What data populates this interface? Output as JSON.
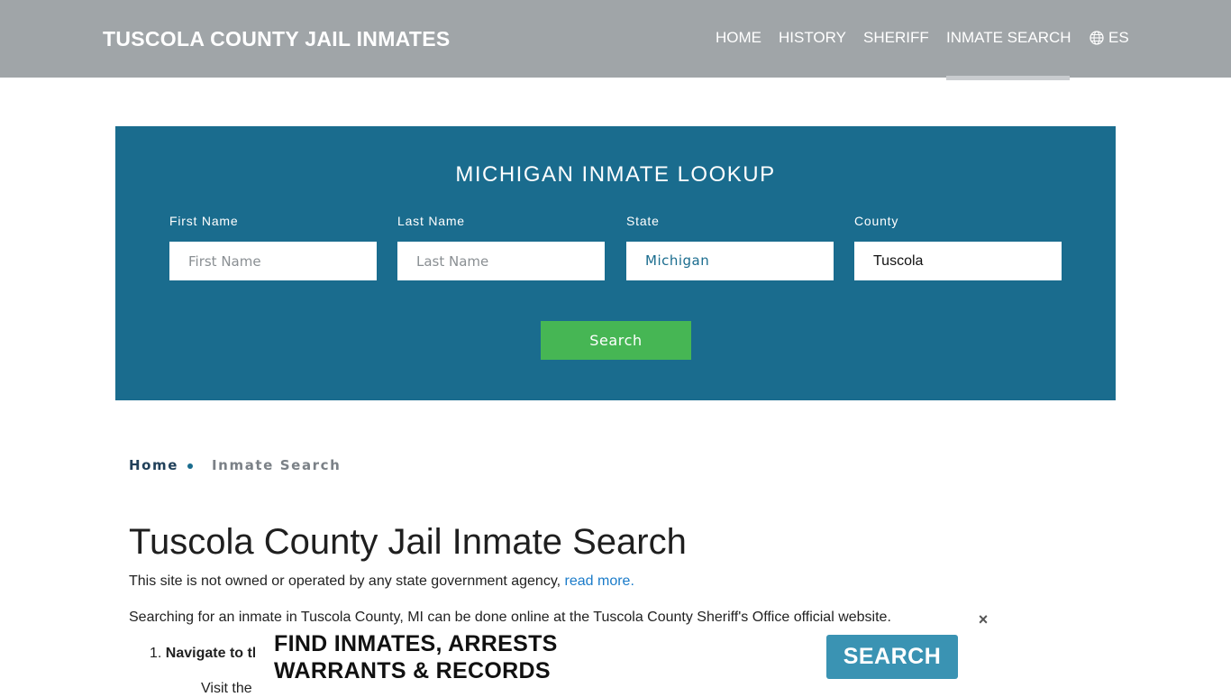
{
  "header": {
    "brand": "TUSCOLA COUNTY JAIL INMATES",
    "nav": [
      {
        "label": "HOME"
      },
      {
        "label": "HISTORY"
      },
      {
        "label": "SHERIFF"
      },
      {
        "label": "INMATE SEARCH",
        "active": true
      },
      {
        "label": "ES",
        "icon": "globe-icon"
      }
    ]
  },
  "lookup": {
    "title": "MICHIGAN INMATE LOOKUP",
    "first_name": {
      "label": "First Name",
      "placeholder": "First Name",
      "value": ""
    },
    "last_name": {
      "label": "Last Name",
      "placeholder": "Last Name",
      "value": ""
    },
    "state": {
      "label": "State",
      "value": "Michigan"
    },
    "county": {
      "label": "County",
      "value": "Tuscola"
    },
    "search_label": "Search"
  },
  "breadcrumb": {
    "home": "Home",
    "current": "Inmate Search"
  },
  "content": {
    "title": "Tuscola County Jail Inmate Search",
    "disclaimer_text": "This site is not owned or operated by any state government agency, ",
    "disclaimer_link": "read more.",
    "paragraph": "Searching for an inmate in Tuscola County, MI can be done online at the Tuscola County Sheriff's Office official website.",
    "list_item_1_bold": "Navigate to th",
    "sub_item_1": "Visit the"
  },
  "ad": {
    "line1": "FIND INMATES, ARRESTS",
    "line2": "WARRANTS & RECORDS",
    "button": "SEARCH",
    "close": "×"
  },
  "colors": {
    "header_bg": "#a0a5a8",
    "lookup_bg": "#1a6c8e",
    "search_button": "#46b654",
    "ad_button": "#3a93b3",
    "link": "#1a7bc9"
  }
}
